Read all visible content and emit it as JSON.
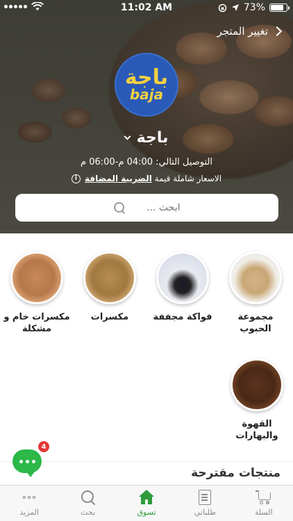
{
  "status_bar": {
    "time": "11:02 AM",
    "battery_percent": "73%",
    "battery_level": 0.73
  },
  "hero": {
    "change_store_label": "تغيير المتجر",
    "logo_arabic": "باجة",
    "logo_english": "baja",
    "store_name": "باجة",
    "delivery_text": "التوصيل التالي: 04:00 م-06:00 م",
    "tax_prefix": "الاسعار شاملة قيمة",
    "tax_link": "الضريبة المضافة",
    "search_placeholder": "ابحث ..."
  },
  "categories": [
    {
      "label": "مجموعة الحبوب",
      "icon": "grains-image"
    },
    {
      "label": "فواكة مجففة",
      "icon": "dried-fruits-image"
    },
    {
      "label": "مكسرات",
      "icon": "nuts-image"
    },
    {
      "label": "مكسرات خام و مشكلة",
      "icon": "raw-mixed-nuts-image"
    },
    {
      "label": "القهوة والبهارات",
      "icon": "coffee-spices-image"
    }
  ],
  "suggested_title": "منتجات مقترحة",
  "chat": {
    "badge_count": "4"
  },
  "tabbar": {
    "tabs": [
      {
        "label": "المزيد",
        "icon": "more-icon",
        "active": false
      },
      {
        "label": "بحث",
        "icon": "search-icon",
        "active": false
      },
      {
        "label": "تسوق",
        "icon": "shop-icon",
        "active": true
      },
      {
        "label": "طلباتي",
        "icon": "orders-icon",
        "active": false
      },
      {
        "label": "السلة",
        "icon": "cart-icon",
        "active": false
      }
    ]
  },
  "colors": {
    "accent_green": "#2e9b3c",
    "chat_green": "#2db84a",
    "badge_red": "#e53935",
    "logo_blue": "#2a5ab8",
    "logo_yellow": "#f4d03f"
  }
}
